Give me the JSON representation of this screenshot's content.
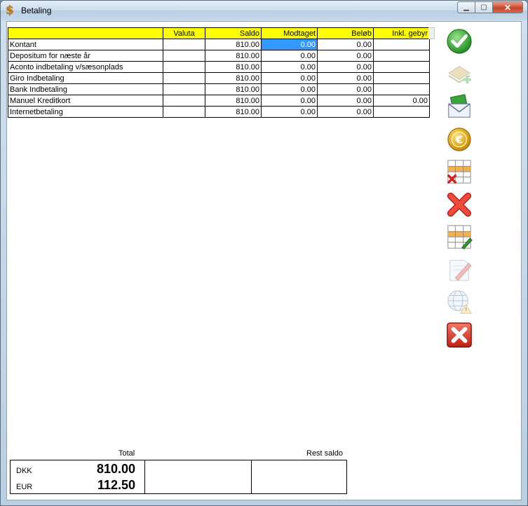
{
  "window": {
    "title": "Betaling",
    "icon": "dollar-icon"
  },
  "table": {
    "headers": [
      "",
      "Valuta",
      "Saldo",
      "Modtaget",
      "Beløb",
      "Inkl. gebyr"
    ],
    "rows": [
      [
        "Kontant",
        "",
        "810.00",
        "0.00",
        "0.00",
        ""
      ],
      [
        "Depositum for næste år",
        "",
        "810.00",
        "0.00",
        "0.00",
        ""
      ],
      [
        "Aconto indbetaling v/sæsonplads",
        "",
        "810.00",
        "0.00",
        "0.00",
        ""
      ],
      [
        "Giro Indbetaling",
        "",
        "810.00",
        "0.00",
        "0.00",
        ""
      ],
      [
        "Bank Indbetaling",
        "",
        "810.00",
        "0.00",
        "0.00",
        ""
      ],
      [
        "Manuel Kreditkort",
        "",
        "810.00",
        "0.00",
        "0.00",
        "0.00"
      ],
      [
        "Internetbetaling",
        "",
        "810.00",
        "0.00",
        "0.00",
        ""
      ]
    ]
  },
  "toolbar": {
    "items": [
      {
        "name": "confirm-check-icon",
        "enabled": true
      },
      {
        "name": "add-money-icon",
        "enabled": false
      },
      {
        "name": "money-envelope-icon",
        "enabled": true
      },
      {
        "name": "euro-coin-icon",
        "enabled": true
      },
      {
        "name": "delete-grid-icon",
        "enabled": true
      },
      {
        "name": "delete-x-icon",
        "enabled": true
      },
      {
        "name": "edit-grid-icon",
        "enabled": true
      },
      {
        "name": "edit-document-icon",
        "enabled": false
      },
      {
        "name": "web-warning-icon",
        "enabled": false
      },
      {
        "name": "close-red-icon",
        "enabled": true
      }
    ]
  },
  "totals": {
    "total_label": "Total",
    "rest_label": "Rest saldo",
    "currencies": [
      {
        "code": "DKK",
        "amount": "810.00"
      },
      {
        "code": "EUR",
        "amount": "112.50"
      }
    ]
  },
  "colors": {
    "header_bg": "#ffff00",
    "selection": "#3399ff"
  }
}
